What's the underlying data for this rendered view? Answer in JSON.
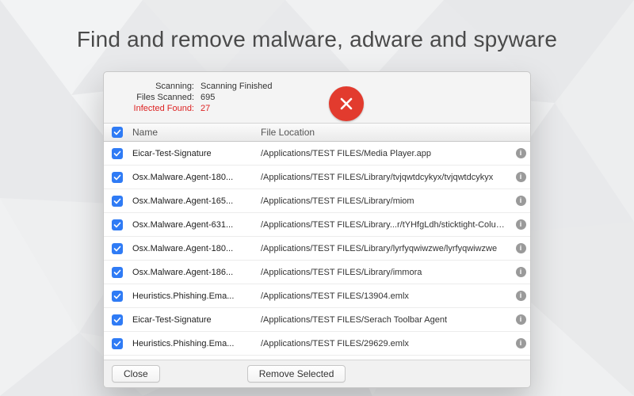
{
  "headline": "Find and remove malware, adware and spyware",
  "summary": {
    "scanning_label": "Scanning:",
    "scanning_value": "Scanning Finished",
    "files_label": "Files Scanned:",
    "files_value": "695",
    "infected_label": "Infected Found:",
    "infected_value": "27"
  },
  "columns": {
    "name": "Name",
    "location": "File Location"
  },
  "rows": [
    {
      "name": "Eicar-Test-Signature",
      "location": "/Applications/TEST FILES/Media Player.app"
    },
    {
      "name": "Osx.Malware.Agent-180...",
      "location": "/Applications/TEST FILES/Library/tvjqwtdcykyx/tvjqwtdcykyx"
    },
    {
      "name": "Osx.Malware.Agent-165...",
      "location": "/Applications/TEST FILES/Library/miom"
    },
    {
      "name": "Osx.Malware.Agent-631...",
      "location": "/Applications/TEST FILES/Library...r/tYHfgLdh/sticktight-Columbine"
    },
    {
      "name": "Osx.Malware.Agent-180...",
      "location": "/Applications/TEST FILES/Library/lyrfyqwiwzwe/lyrfyqwiwzwe"
    },
    {
      "name": "Osx.Malware.Agent-186...",
      "location": "/Applications/TEST FILES/Library/immora"
    },
    {
      "name": "Heuristics.Phishing.Ema...",
      "location": "/Applications/TEST FILES/13904.emlx"
    },
    {
      "name": "Eicar-Test-Signature",
      "location": "/Applications/TEST FILES/Serach Toolbar Agent"
    },
    {
      "name": "Heuristics.Phishing.Ema...",
      "location": "/Applications/TEST FILES/29629.emlx"
    }
  ],
  "buttons": {
    "close": "Close",
    "remove": "Remove Selected"
  },
  "icons": {
    "stop": "close-icon",
    "info": "i"
  }
}
